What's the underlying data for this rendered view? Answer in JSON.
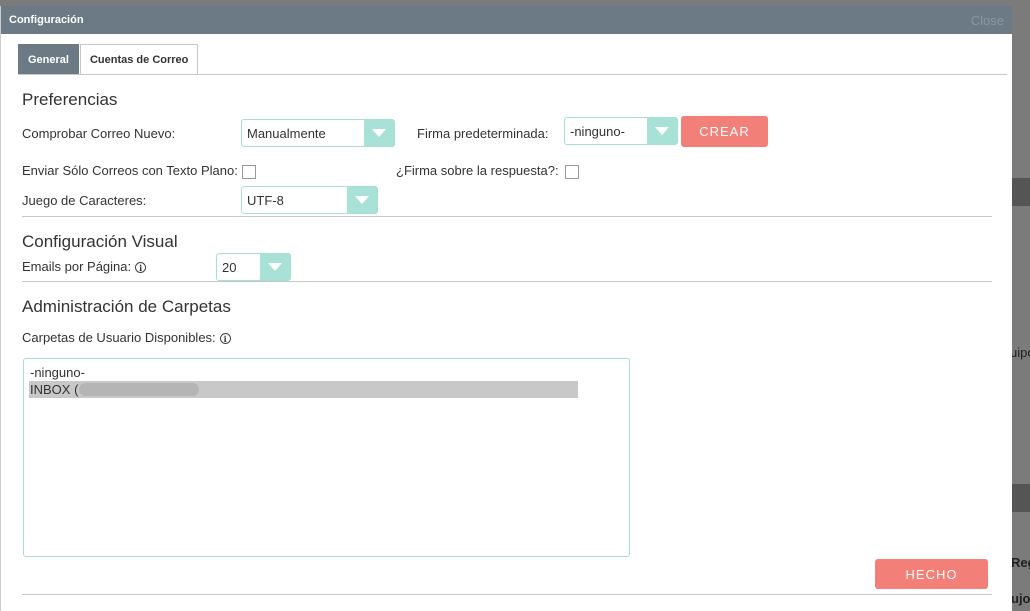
{
  "dialog": {
    "title": "Configuración",
    "close_label": "Close"
  },
  "tabs": [
    {
      "label": "General",
      "active": true
    },
    {
      "label": "Cuentas de Correo",
      "active": false
    }
  ],
  "preferences": {
    "title": "Preferencias",
    "check_mail_label": "Comprobar Correo Nuevo:",
    "check_mail_value": "Manualmente",
    "signature_label": "Firma predeterminada:",
    "signature_value": "-ninguno-",
    "create_button": "CREAR",
    "plain_text_label": "Enviar Sólo Correos con Texto Plano:",
    "plain_text_checked": false,
    "signature_above_label": "¿Firma sobre la respuesta?:",
    "signature_above_checked": false,
    "charset_label": "Juego de Caracteres:",
    "charset_value": "UTF-8"
  },
  "visual": {
    "title": "Configuración Visual",
    "emails_per_page_label": "Emails por Página:",
    "emails_per_page_value": "20"
  },
  "folders": {
    "title": "Administración de Carpetas",
    "available_label": "Carpetas de Usuario Disponibles:",
    "options": [
      "-ninguno-",
      "INBOX ("
    ],
    "selected_index": 1
  },
  "done_button": "HECHO",
  "background": {
    "text_1": "uipo",
    "text_2": "Reg",
    "text_3": "ujo:"
  },
  "colors": {
    "titlebar": "#6b7a85",
    "accent": "#a8e2d6",
    "button": "#f27f78"
  }
}
